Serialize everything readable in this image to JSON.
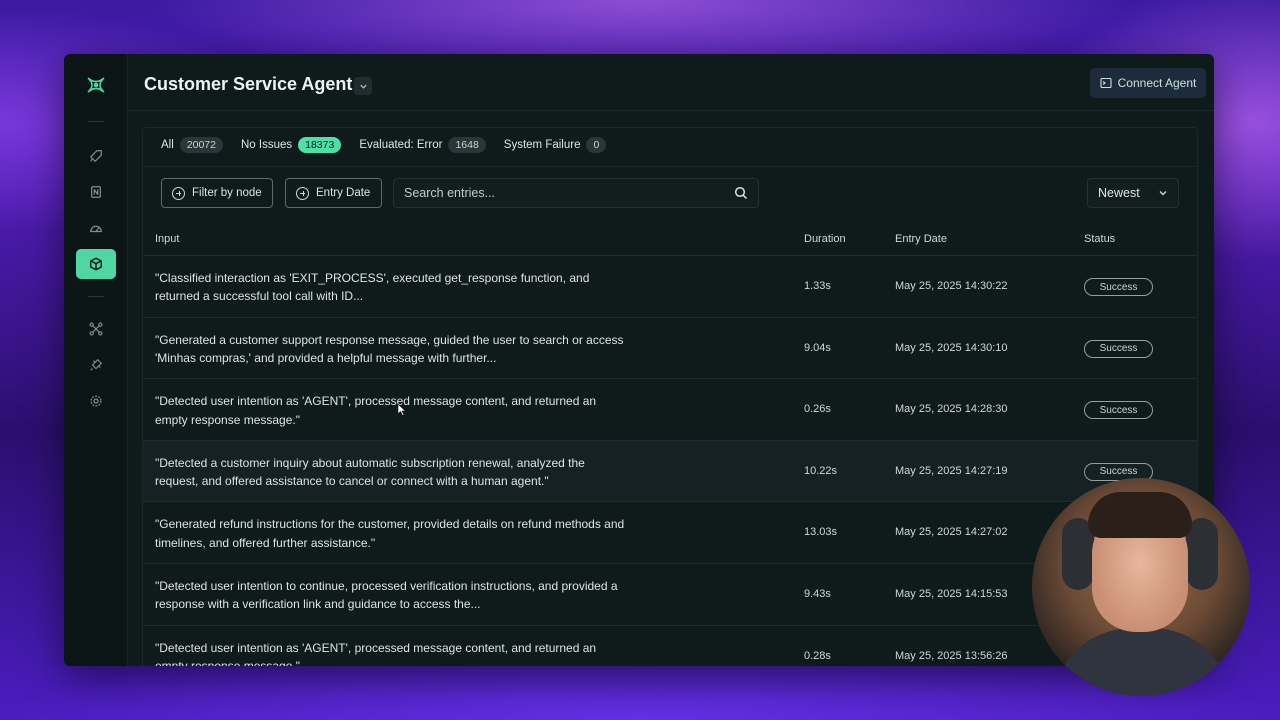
{
  "header": {
    "title": "Customer Service Agent",
    "connect_label": "Connect Agent"
  },
  "sidebar": {
    "items": [
      {
        "name": "rocket-icon"
      },
      {
        "name": "notebook-icon"
      },
      {
        "name": "gauge-icon"
      },
      {
        "name": "cube-icon",
        "active": true
      },
      {
        "name": "network-icon"
      },
      {
        "name": "plug-icon"
      },
      {
        "name": "gear-icon"
      }
    ]
  },
  "filters": {
    "tabs": [
      {
        "label": "All",
        "count": "20072"
      },
      {
        "label": "No Issues",
        "count": "18373"
      },
      {
        "label": "Evaluated: Error",
        "count": "1648"
      },
      {
        "label": "System Failure",
        "count": "0"
      }
    ],
    "filter_by_node": "Filter by node",
    "entry_date": "Entry Date",
    "search_placeholder": "Search entries...",
    "sort": "Newest"
  },
  "table": {
    "headers": {
      "input": "Input",
      "duration": "Duration",
      "entry_date": "Entry Date",
      "status": "Status"
    },
    "rows": [
      {
        "input": "\"Classified interaction as 'EXIT_PROCESS', executed get_response function, and returned a successful tool call with ID...",
        "duration": "1.33s",
        "date": "May 25, 2025 14:30:22",
        "status": "Success"
      },
      {
        "input": "\"Generated a customer support response message, guided the user to search or access 'Minhas compras,' and provided a helpful message with further...",
        "duration": "9.04s",
        "date": "May 25, 2025 14:30:10",
        "status": "Success"
      },
      {
        "input": "\"Detected user intention as 'AGENT', processed message content, and returned an empty response message.\"",
        "duration": "0.26s",
        "date": "May 25, 2025 14:28:30",
        "status": "Success"
      },
      {
        "input": "\"Detected a customer inquiry about automatic subscription renewal, analyzed the request, and offered assistance to cancel or connect with a human agent.\"",
        "duration": "10.22s",
        "date": "May 25, 2025 14:27:19",
        "status": "Success"
      },
      {
        "input": "\"Generated refund instructions for the customer, provided details on refund methods and timelines, and offered further assistance.\"",
        "duration": "13.03s",
        "date": "May 25, 2025 14:27:02",
        "status": ""
      },
      {
        "input": "\"Detected user intention to continue, processed verification instructions, and provided a response with a verification link and guidance to access the...",
        "duration": "9.43s",
        "date": "May 25, 2025 14:15:53",
        "status": ""
      },
      {
        "input": "\"Detected user intention as 'AGENT', processed message content, and returned an empty response message.\"",
        "duration": "0.28s",
        "date": "May 25, 2025 13:56:26",
        "status": ""
      }
    ]
  },
  "colors": {
    "accent": "#4fd6a2",
    "background": "#0f1a1b"
  }
}
